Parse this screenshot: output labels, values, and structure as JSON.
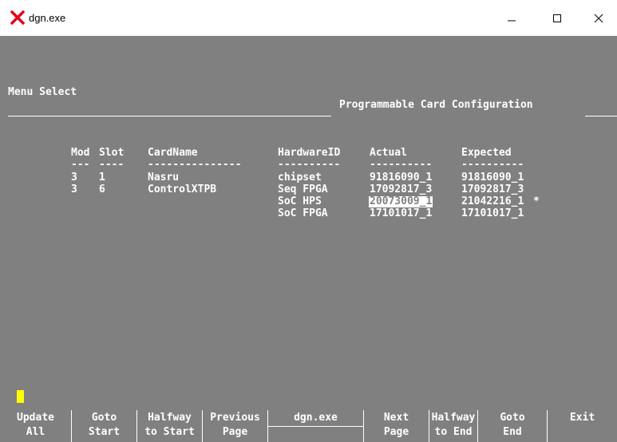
{
  "window": {
    "title": "dgn.exe",
    "minimize_glyph": "—",
    "maximize_glyph": "☐",
    "close_glyph": "✕",
    "icon_color": "#e8001c"
  },
  "screen": {
    "menu_label": "Menu Select",
    "heading": "Programmable Card Configuration",
    "columns": {
      "mod": "Mod",
      "slot": "Slot",
      "card_name": "CardName",
      "hardware_id": "HardwareID",
      "actual": "Actual",
      "expected": "Expected"
    },
    "separators": {
      "mod": "---",
      "slot": "----",
      "card_name": "---------------",
      "hardware_id": "----------",
      "actual": "----------",
      "expected": "----------"
    },
    "rows": [
      {
        "mod": "3",
        "slot": "1",
        "card_name": "Nasru",
        "hardware_id": "chipset",
        "actual": "91816090_1",
        "expected": "91816090_1",
        "flag": ""
      },
      {
        "mod": "3",
        "slot": "6",
        "card_name": "ControlXTPB",
        "hardware_id": "Seq FPGA",
        "actual": "17092817_3",
        "expected": "17092817_3",
        "flag": ""
      },
      {
        "mod": "",
        "slot": "",
        "card_name": "",
        "hardware_id": "SoC HPS",
        "actual": "20073009_1",
        "expected": "21042216_1",
        "flag": "*"
      },
      {
        "mod": "",
        "slot": "",
        "card_name": "",
        "hardware_id": "SoC FPGA",
        "actual": "17101017_1",
        "expected": "17101017_1",
        "flag": ""
      }
    ]
  },
  "function_keys": [
    {
      "line1": "Update",
      "line2": "All"
    },
    {
      "line1": "Goto",
      "line2": "Start"
    },
    {
      "line1": "Halfway",
      "line2": "to Start"
    },
    {
      "line1": "Previous",
      "line2": "Page"
    },
    {
      "line1": "dgn.exe",
      "line2": ""
    },
    {
      "line1": "Next",
      "line2": "Page"
    },
    {
      "line1": "Halfway",
      "line2": "to End"
    },
    {
      "line1": "Goto",
      "line2": "End"
    },
    {
      "line1": "Exit",
      "line2": ""
    }
  ],
  "colors": {
    "terminal_bg": "#808080",
    "terminal_fg": "#ffffff",
    "cursor": "#ffff00"
  }
}
